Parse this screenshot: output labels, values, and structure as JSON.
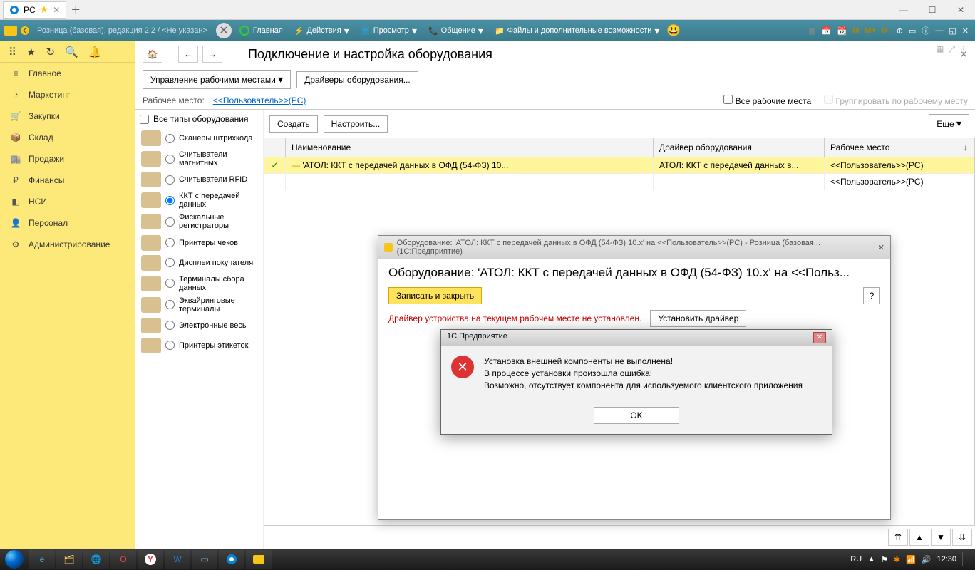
{
  "window": {
    "tab": "PC",
    "minimize": "—",
    "maximize": "☐",
    "close": "✕"
  },
  "toolbar": {
    "breadcrumb": "Розница (базовая), редакция 2.2 / <Не указан>",
    "main": "Главная",
    "actions": "Действия",
    "view": "Просмотр",
    "chat": "Общение",
    "files": "Файлы и дополнительные возможности",
    "m": "M",
    "mplus": "M+",
    "mminus": "M-"
  },
  "nav": {
    "main": "Главное",
    "marketing": "Маркетинг",
    "purchases": "Закупки",
    "warehouse": "Склад",
    "sales": "Продажи",
    "finance": "Финансы",
    "nsi": "НСИ",
    "personnel": "Персонал",
    "admin": "Администрирование"
  },
  "page": {
    "title": "Подключение и настройка оборудования",
    "manage_btn": "Управление рабочими местами",
    "drivers_btn": "Драйверы оборудования...",
    "workplace_lbl": "Рабочее место:",
    "workplace_link": "<<Пользователь>>(PC)",
    "all_workplaces": "Все рабочие места",
    "group_by": "Группировать по рабочему месту",
    "create": "Создать",
    "configure": "Настроить...",
    "more": "Еще"
  },
  "eqtypes": {
    "all": "Все типы оборудования",
    "list": [
      "Сканеры штрихкода",
      "Считыватели магнитных",
      "Считыватели RFID",
      "ККТ с передачей данных",
      "Фискальные регистраторы",
      "Принтеры чеков",
      "Дисплеи покупателя",
      "Терминалы сбора данных",
      "Эквайринговые терминалы",
      "Электронные весы",
      "Принтеры этикеток"
    ],
    "selected_index": 3
  },
  "grid": {
    "cols": {
      "name": "Наименование",
      "driver": "Драйвер оборудования",
      "workplace": "Рабочее место"
    },
    "rows": [
      {
        "check": "✓",
        "name": "'АТОЛ: ККТ с передачей данных в ОФД (54-ФЗ) 10...",
        "driver": "АТОЛ: ККТ с передачей данных в...",
        "workplace": "<<Пользователь>>(PC)",
        "sel": true
      },
      {
        "check": "",
        "name": "",
        "driver": "",
        "workplace": "<<Пользователь>>(PC)",
        "sel": false
      }
    ]
  },
  "modal1": {
    "titlebar": "Оборудование: 'АТОЛ: ККТ с передачей данных в ОФД (54-ФЗ) 10.x' на <<Пользователь>>(PC) - Розница (базовая... (1С:Предприятие)",
    "heading": "Оборудование: 'АТОЛ: ККТ с передачей данных в ОФД (54-ФЗ) 10.x' на <<Польз...",
    "save_close": "Записать и закрыть",
    "error": "Драйвер устройства на текущем рабочем месте не установлен.",
    "install": "Установить драйвер"
  },
  "modal2": {
    "titlebar": "1С:Предприятие",
    "line1": "Установка внешней компоненты не выполнена!",
    "line2": "В процессе установки произошла ошибка!",
    "line3": "Возможно, отсутствует компонента для используемого клиентского приложения",
    "ok": "OK"
  },
  "tray": {
    "lang": "RU",
    "time": "12:30"
  }
}
